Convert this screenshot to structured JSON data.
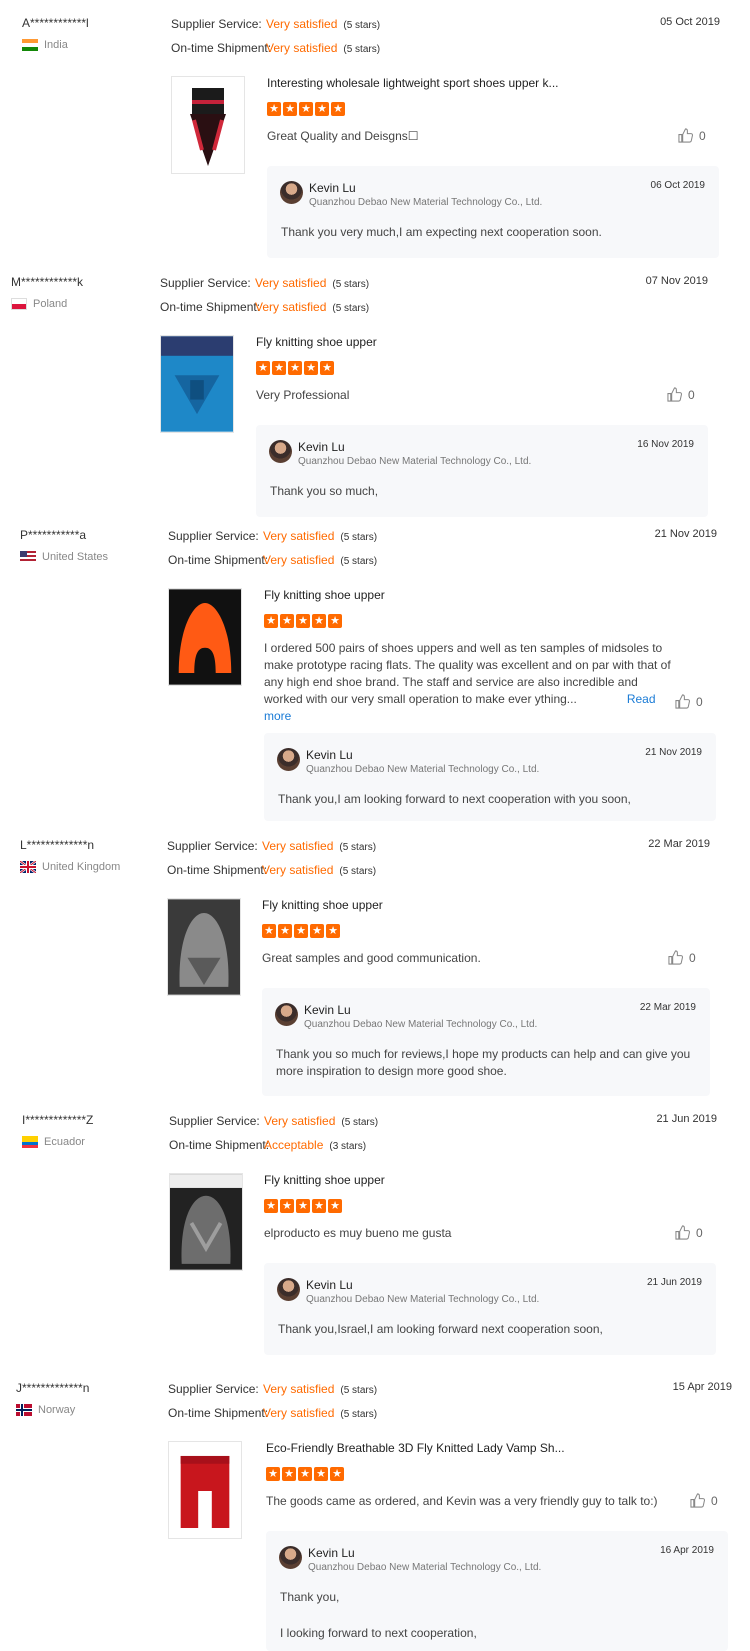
{
  "labels": {
    "supplier_service": "Supplier Service:",
    "ontime_shipment": "On-time Shipment:",
    "read_more": "Read more"
  },
  "colors": {
    "accent": "#ff6a00",
    "link": "#1a7bd6",
    "reply_bg": "#f7f8fa"
  },
  "reviews": [
    {
      "buyer": "A************l",
      "country": "India",
      "supplier_value": "Very satisfied",
      "supplier_stars": "(5 stars)",
      "shipment_value": "Very satisfied",
      "shipment_stars": "(5 stars)",
      "date": "05 Oct 2019",
      "product": "Interesting wholesale lightweight sport shoes upper k...",
      "rating": 5,
      "comment": "Great Quality and Deisgns☐",
      "likes": "0",
      "reply": {
        "name": "Kevin Lu",
        "company": "Quanzhou Debao New Material Technology Co., Ltd.",
        "date": "06 Oct 2019",
        "text": "Thank you very much,I am expecting next cooperation soon."
      }
    },
    {
      "buyer": "M************k",
      "country": "Poland",
      "supplier_value": "Very satisfied",
      "supplier_stars": "(5 stars)",
      "shipment_value": "Very satisfied",
      "shipment_stars": "(5 stars)",
      "date": "07 Nov 2019",
      "product": "Fly knitting shoe upper",
      "rating": 5,
      "comment": "Very Professional",
      "likes": "0",
      "reply": {
        "name": "Kevin Lu",
        "company": "Quanzhou Debao New Material Technology Co., Ltd.",
        "date": "16 Nov 2019",
        "text": "Thank you so much,"
      }
    },
    {
      "buyer": "P***********a",
      "country": "United States",
      "supplier_value": "Very satisfied",
      "supplier_stars": "(5 stars)",
      "shipment_value": "Very satisfied",
      "shipment_stars": "(5 stars)",
      "date": "21 Nov 2019",
      "product": "Fly knitting shoe upper",
      "rating": 5,
      "comment": "I ordered 500 pairs of shoes uppers and well as ten samples of midsoles to make prototype racing flats. The quality was excellent and on par with that of any high end shoe brand. The staff and service are also incredible and worked with our very small operation to make ever ything...",
      "likes": "0",
      "reply": {
        "name": "Kevin Lu",
        "company": "Quanzhou Debao New Material Technology Co., Ltd.",
        "date": "21 Nov 2019",
        "text": "Thank you,I am looking forward to next cooperation with  you soon,"
      }
    },
    {
      "buyer": "L*************n",
      "country": "United Kingdom",
      "supplier_value": "Very satisfied",
      "supplier_stars": "(5 stars)",
      "shipment_value": "Very satisfied",
      "shipment_stars": "(5 stars)",
      "date": "22 Mar 2019",
      "product": "Fly knitting shoe upper",
      "rating": 5,
      "comment": "Great samples and good communication.",
      "likes": "0",
      "reply": {
        "name": "Kevin Lu",
        "company": "Quanzhou Debao New Material Technology Co., Ltd.",
        "date": "22 Mar 2019",
        "text": "Thank you so much for reviews,I hope my products can help and can give you more inspiration to design more good shoe."
      }
    },
    {
      "buyer": "I*************Z",
      "country": "Ecuador",
      "supplier_value": "Very satisfied",
      "supplier_stars": "(5 stars)",
      "shipment_value": "Acceptable",
      "shipment_stars": "(3 stars)",
      "date": "21 Jun 2019",
      "product": "Fly knitting shoe upper",
      "rating": 5,
      "comment": "elproducto es muy bueno me gusta",
      "likes": "0",
      "reply": {
        "name": "Kevin Lu",
        "company": "Quanzhou Debao New Material Technology Co., Ltd.",
        "date": "21 Jun 2019",
        "text": "Thank you,Israel,I am looking forward next cooperation soon,"
      }
    },
    {
      "buyer": "J*************n",
      "country": "Norway",
      "supplier_value": "Very satisfied",
      "supplier_stars": "(5 stars)",
      "shipment_value": "Very satisfied",
      "shipment_stars": "(5 stars)",
      "date": "15 Apr 2019",
      "product": "Eco-Friendly Breathable 3D Fly Knitted Lady Vamp Sh...",
      "rating": 5,
      "comment": "The goods came as ordered, and Kevin was a very friendly guy to talk to:)",
      "likes": "0",
      "reply": {
        "name": "Kevin Lu",
        "company": "Quanzhou Debao New Material Technology Co., Ltd.",
        "date": "16 Apr 2019",
        "text": "Thank you,",
        "text2": "I looking forward to next cooperation,"
      }
    }
  ]
}
